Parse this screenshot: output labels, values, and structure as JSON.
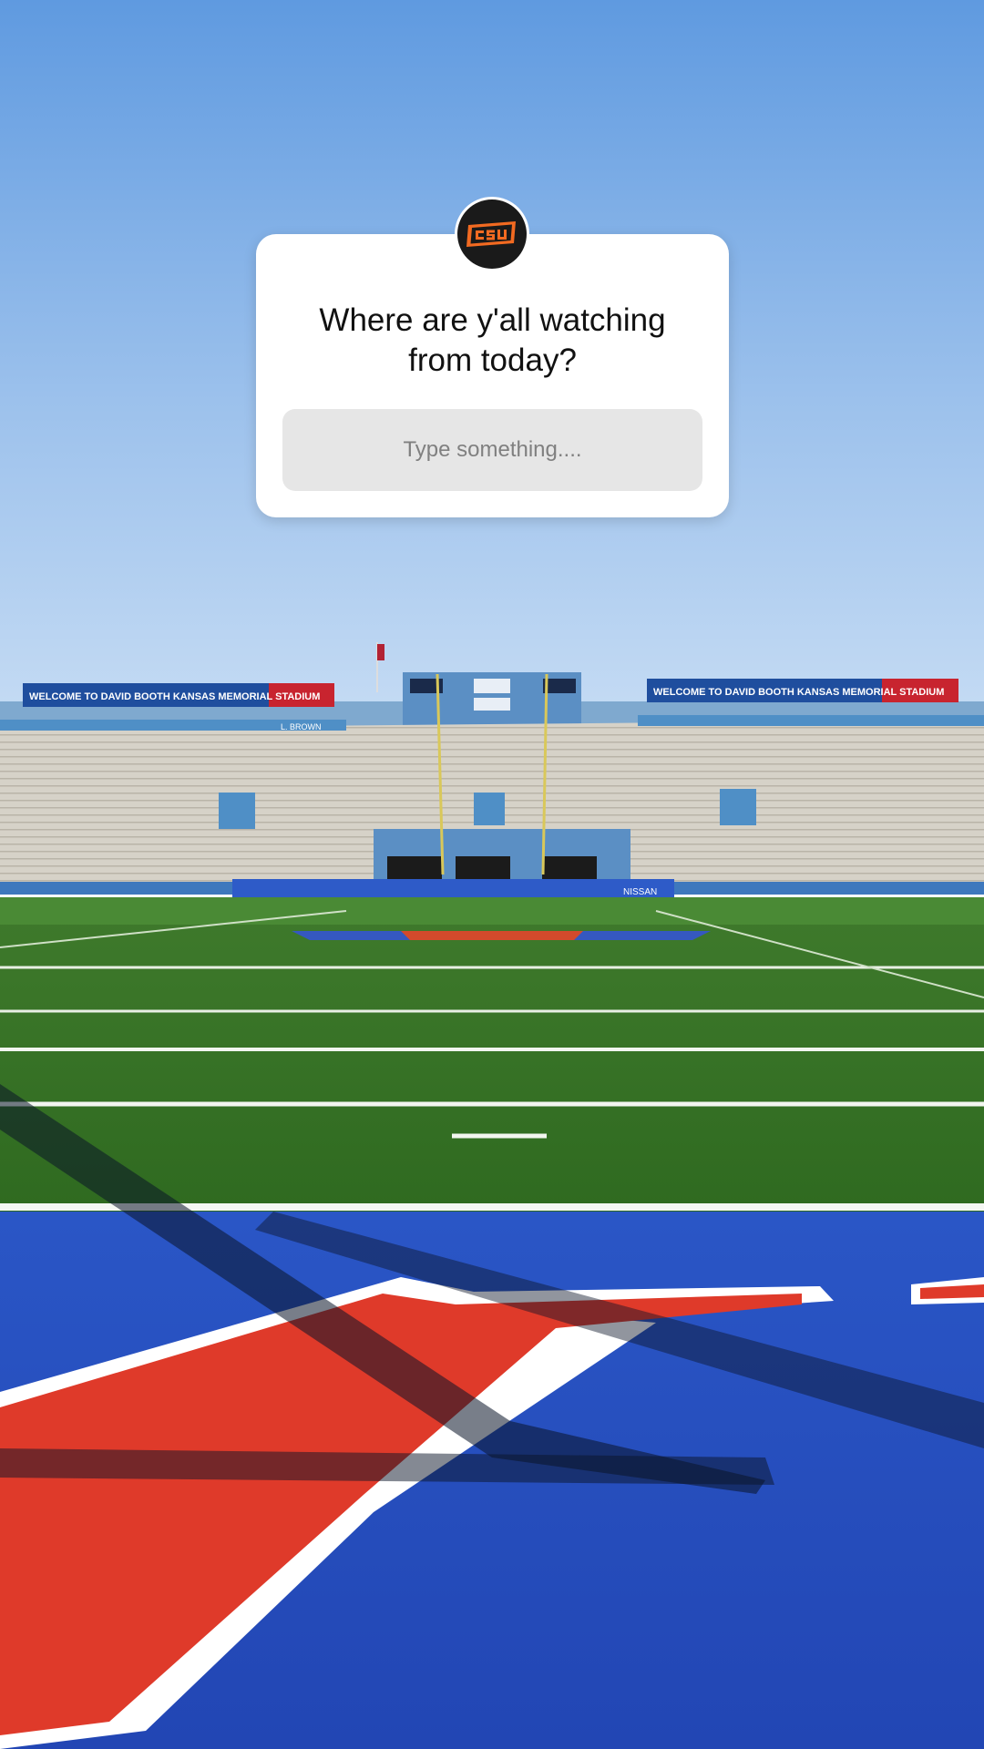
{
  "story": {
    "account_logo": "osu-logo-icon",
    "question": "Where are y'all watching\nfrom today?",
    "answer_placeholder": "Type something....",
    "colors": {
      "sticker_bg": "#ffffff",
      "input_bg": "#e6e6e6",
      "logo_orange": "#f26a21",
      "logo_bg": "#1a1a1a"
    }
  },
  "background_photo": {
    "banner_left": "WELCOME TO DAVID BOOTH KANSAS MEMORIAL STADIUM",
    "banner_right": "WELCOME TO DAVID BOOTH KANSAS MEMORIAL STADIUM",
    "scoreboard_tag": "L. BROWN",
    "ad_board": "NISSAN"
  }
}
